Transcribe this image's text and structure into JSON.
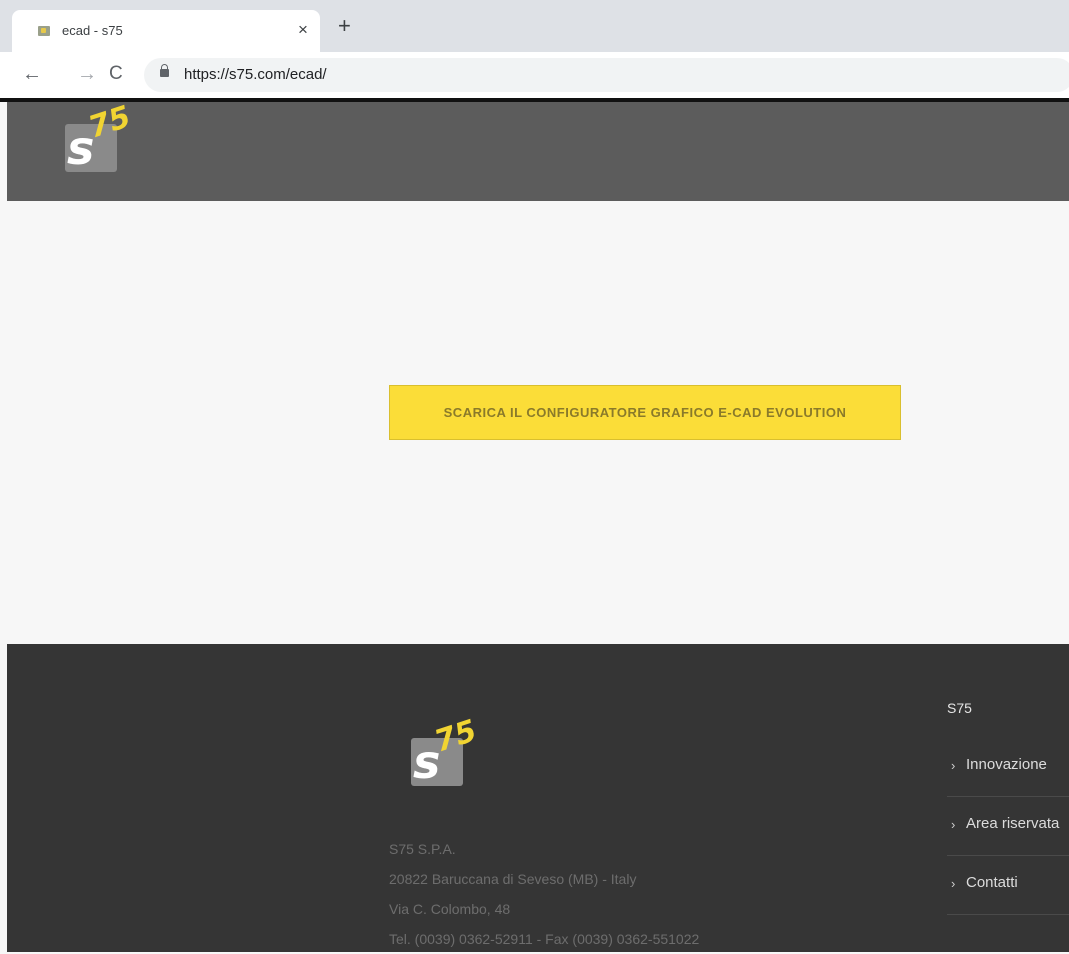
{
  "browser": {
    "tab_title": "ecad - s75",
    "close_glyph": "×",
    "new_tab_glyph": "+",
    "url": "https://s75.com/ecad/",
    "back_glyph": "←",
    "forward_glyph": "→",
    "reload_glyph": "C"
  },
  "logo": {
    "letter": "s",
    "number": "75"
  },
  "main": {
    "cta_label": "SCARICA IL CONFIGURATORE GRAFICO E-CAD EVOLUTION"
  },
  "footer": {
    "company": "S75 S.P.A.",
    "address_city": "20822 Baruccana di Seveso (MB) - Italy",
    "address_street": "Via C. Colombo, 48",
    "phone_fax": "Tel. (0039) 0362-52911 - Fax (0039) 0362-551022",
    "menu_heading": "S75",
    "menu_items": [
      {
        "label": "Innovazione"
      },
      {
        "label": "Area riservata"
      },
      {
        "label": "Contatti"
      }
    ],
    "chevron": "›"
  },
  "colors": {
    "header_bg": "#5c5c5c",
    "footer_bg": "#353535",
    "cta_bg": "#fbdd38",
    "logo_accent": "#f1d432"
  }
}
